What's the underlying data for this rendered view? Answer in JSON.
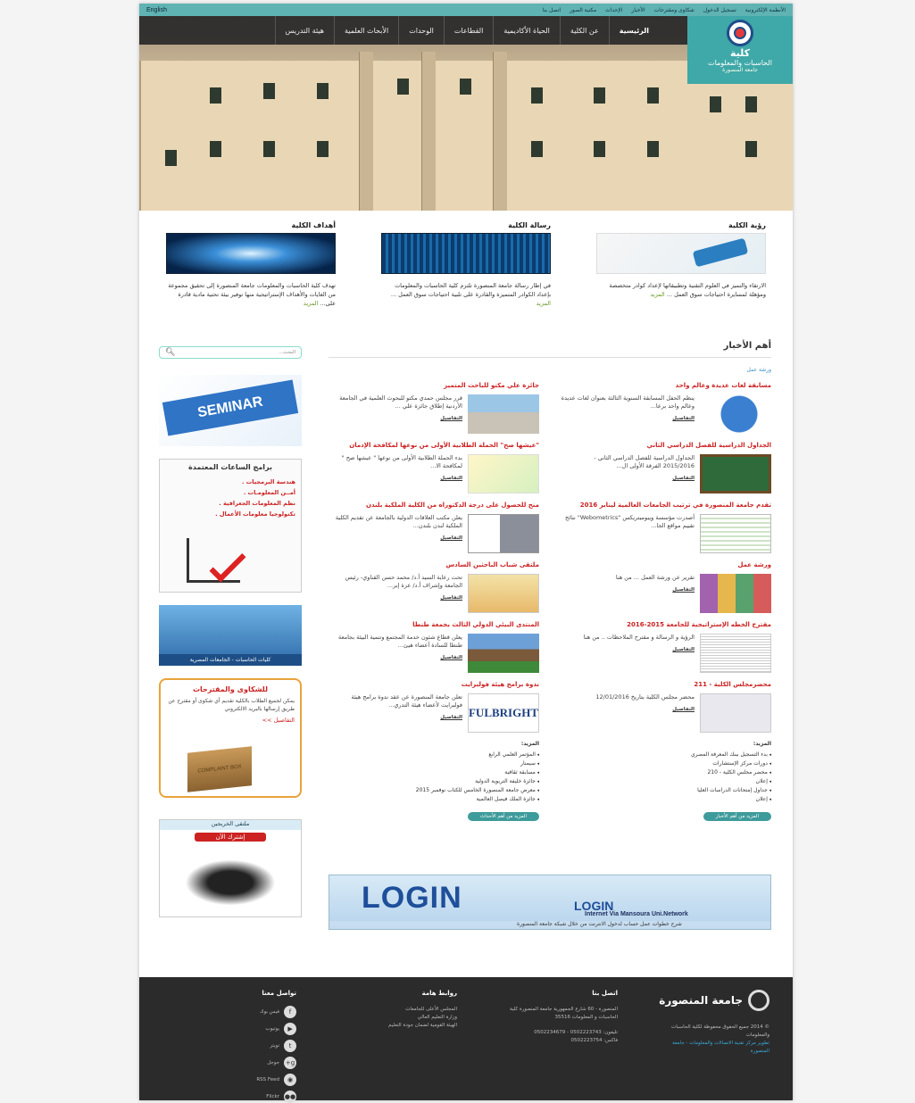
{
  "topbar": {
    "links": [
      "الأنظمة الإلكترونية",
      "تسجيل الدخول",
      "شكاوى ومقترحات",
      "الأخبار",
      "الإحداث",
      "مكتبة الصور",
      "اتصل بنا"
    ],
    "english": "English"
  },
  "logo": {
    "line1": "كلية",
    "line2": "الحاسبات والمعلومات",
    "line3": "جامعة المنصورة"
  },
  "nav": [
    "الرئيسية",
    "عن الكلية",
    "الحياة الأكاديمية",
    "القطاعات",
    "الوحدات",
    "الأبحاث العلمية",
    "هيئة التدريس"
  ],
  "features": [
    {
      "title": "رؤية الكلية",
      "text": "الارتقاء والتميز في العلوم التقنية وتطبيقاتها لإعداد كوادر متخصصة ومؤهلة لمسايرة احتياجات سوق العمل ...",
      "more": "المزيد"
    },
    {
      "title": "رسالة الكلية",
      "text": "في إطار رسالة جامعة المنصورة تلتزم كلية الحاسبات والمعلومات بإعداد الكوادر المتميزة والقادرة على تلبية احتياجات سوق العمل ...",
      "more": "المزيد"
    },
    {
      "title": "أهداف الكلية",
      "text": "تهدف كلية الحاسبات والمعلومات جامعة المنصورة إلى تحقيق مجموعة من الغايات والأهداف الإستراتيجية منها توفير بيئة تحتية مادية قادرة على...",
      "more": "المزيد"
    }
  ],
  "news": {
    "heading": "أهم الأخبار",
    "crumb": "ورشة عمل",
    "details": "التفاصيل",
    "right": [
      {
        "title": "مسابقة لغات عديدة وعالم واحد",
        "text": "ينظم الحفل المسابقة السنوية الثالثة بعنوان لغات عديدة وعالم واحد برعا...",
        "thumb": "globe"
      },
      {
        "title": "الجداول الدراسية للفصل الدراسي الثاني",
        "text": "الجداول الدراسية للفصل الدراسي الثاني - 2015/2016 الفرقة الأولى ال...",
        "thumb": "tables"
      },
      {
        "title": "تقدم جامعة المنصورة في ترتيب الجامعات العالمية لينابر 2016",
        "text": "أصدرت مؤسسة ويبوميتريكس \"Webometrics\" نتائج تقييم مواقع الجا...",
        "thumb": "webo"
      },
      {
        "title": "ورشة عمل",
        "text": "تقرير عن ورشة العمل ... من هنا",
        "thumb": "logos"
      },
      {
        "title": "مقترح الخطه الإستراتيجية للجامعة 2015-2016",
        "text": "الرؤية و الرسالة و مقترح الملاحظات .. من هنا",
        "thumb": "doc"
      },
      {
        "title": "محضرمجلس الكلية - 211",
        "text": "محضر مجلس الكلية بتاريخ 12/01/2016",
        "thumb": "doc2"
      }
    ],
    "left": [
      {
        "title": "جائزة علي مكتو للباحث المتميز",
        "text": "قرر مجلس حمدي مكتو للبحوث العلمية في الجامعة الأردنية إطلاق جائزة علي ...",
        "thumb": "bldg"
      },
      {
        "title": "\"عيشها صح\" الحملة الطلابية الأولى من نوعها لمكافحة الإدمان",
        "text": "بدء الحملة الطلابية الأولى من نوعها \" عيشها صح \" لمكافحة الا...",
        "thumb": "campaign"
      },
      {
        "title": "منح للحصول على درجة الدكتوراه من الكلية الملكية بلندن",
        "text": "يعلن مكتب العلاقات الدولية بالجامعة عن تقديم الكلية الملكية لندن بلندن...",
        "thumb": "kings"
      },
      {
        "title": "ملتقى شباب الباحثين السادس",
        "text": "تحت رعاية السيد أ.د/ محمد حسن القناوي- رئيس الجامعة وإشراف أ.د/ عزة إبر...",
        "thumb": "poster"
      },
      {
        "title": "المنتدى البيئي الدولي الثالث بجمعة طنطا",
        "text": "يعلن قطاع شئون خدمة المجتمع وتنمية البيئة بجامعة طنطا للسادة أعضاء هيئ...",
        "thumb": "city"
      },
      {
        "title": "ندوة برامج هيئة فولبرايت",
        "text": "تعلن جامعة المنصورة عن عقد ندوة برامج هيئة فولبرايت لأعضاء هيئة التدري...",
        "thumb": "fulbright"
      }
    ],
    "more_label": "المزيد:",
    "more_right": [
      "بدء التسجيل ببنك المعرفة المصري",
      "دورات مركز الإستشارات",
      "محضر مجلس الكلية - 210",
      "إعلان",
      "جداول إمتحانات الدراسات العليا",
      "إعلان"
    ],
    "more_left": [
      "المؤتمر العلمي الرابع",
      "سيمنار",
      "مسابقة ثقافية",
      "جائزة خليفة التربوية الدولية",
      "معرض جامعة المنصورة الخامس للكتاب نوفمبر 2015",
      "جائزة الملك فيصل العالمية"
    ],
    "btn_right": "المزيد من أهم الأخبار",
    "btn_left": "المزيد من أهم الأحداث"
  },
  "side": {
    "search_placeholder": "البحث...",
    "seminar": "SEMINAR",
    "hours_title": "برامج الساعات المعتمدة",
    "hours_items": [
      "هندسة البرمجيات .",
      "أمــن المعلومـات .",
      "نظم المعلومات الجغرافية .",
      "تكنولوجيا معلومات الأعمال ."
    ],
    "colleges": "كليات الحاسبات - الجامعات المصرية",
    "complaints_title": "للشكاوى والمقترحات",
    "complaints_text": "يمكن لجميع الطلاب بالكلية تقديم أي شكوى أو مقترح عن طريق إرسالها بالبريد الالكتروني",
    "complaints_more": "التفاصيل >>",
    "box_label": "COMPLAINT BOX",
    "grad_title": "ملتقى الخريجين",
    "grad_btn": "إشترك الآن"
  },
  "login": {
    "big": "LOGIN",
    "small": "LOGIN",
    "sub": "Internet Via Mansoura Uni.Network",
    "bar": "شرح خطوات عمل حساب لدخول الانترنت من خلال شبكة جامعة المنصورة"
  },
  "footer": {
    "uni": "جامعة المنصورة",
    "copy": "© 2014 جميع الحقوق محفوظة لكلية الحاسبات والمعلومات",
    "dev": "تطوير مركز تقنية الاتصالات والمعلومات - جامعة المنصورة",
    "contact_title": "اتصل بنا",
    "address": "المنصورة - 60 شارع الجمهورية جامعة المنصورة كلية الحاسبات و المعلومات 35516",
    "phone": "تليفون: 0502223743 - 0502234679",
    "fax": "فاكس: 0502223754",
    "links_title": "روابط هامة",
    "links": [
      "المجلس الأعلى للجامعات",
      "وزارة التعليم العالي",
      "الهيئة القومية لضمان جودة التعليم"
    ],
    "social_title": "تواصل معنا",
    "social": [
      {
        "label": "فيس بوك",
        "icon": "f"
      },
      {
        "label": "يوتيوب",
        "icon": "▶"
      },
      {
        "label": "تويتر",
        "icon": "t"
      },
      {
        "label": "جوجل",
        "icon": "g+"
      },
      {
        "label": "RSS Feed",
        "icon": "◉"
      },
      {
        "label": "Flickr",
        "icon": "●●"
      }
    ]
  },
  "colors": {
    "teal": "#3fa8a8",
    "red": "#cc2222",
    "dark": "#2b2b2b"
  }
}
